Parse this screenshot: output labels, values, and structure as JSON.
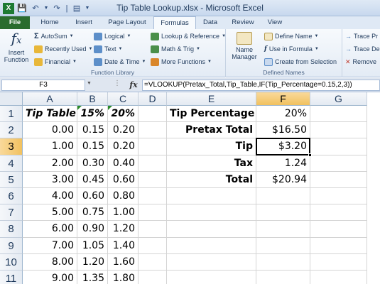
{
  "window": {
    "title": "Tip Table Lookup.xlsx - Microsoft Excel"
  },
  "tabs": [
    "File",
    "Home",
    "Insert",
    "Page Layout",
    "Formulas",
    "Data",
    "Review",
    "View"
  ],
  "ribbon": {
    "function_library": {
      "label": "Function Library",
      "insert_function": "Insert Function",
      "insert_line1": "Insert",
      "insert_line2": "Function",
      "autosum": "AutoSum",
      "recently_used": "Recently Used",
      "financial": "Financial",
      "logical": "Logical",
      "text": "Text",
      "date_time": "Date & Time",
      "lookup_reference": "Lookup & Reference",
      "math_trig": "Math & Trig",
      "more_functions": "More Functions"
    },
    "defined_names": {
      "label": "Defined Names",
      "name_manager_line1": "Name",
      "name_manager_line2": "Manager",
      "define_name": "Define Name",
      "use_in_formula": "Use in Formula",
      "create_from_selection": "Create from Selection"
    },
    "formula_auditing": {
      "trace_precedents": "Trace Pr",
      "trace_dependents": "Trace De",
      "remove_arrows": "Remove"
    }
  },
  "formula_bar": {
    "name_box": "F3",
    "fx": "fx",
    "formula": "=VLOOKUP(Pretax_Total,Tip_Table,IF(Tip_Percentage=0.15,2,3))"
  },
  "columns": [
    "A",
    "B",
    "C",
    "D",
    "E",
    "F",
    "G"
  ],
  "rows": [
    "1",
    "2",
    "3",
    "4",
    "5",
    "6",
    "7",
    "8",
    "9",
    "10",
    "11"
  ],
  "cells": {
    "A": [
      "Tip Table",
      "0.00",
      "1.00",
      "2.00",
      "3.00",
      "4.00",
      "5.00",
      "6.00",
      "7.00",
      "8.00",
      "9.00"
    ],
    "B": [
      "15%",
      "0.15",
      "0.15",
      "0.30",
      "0.45",
      "0.60",
      "0.75",
      "0.90",
      "1.05",
      "1.20",
      "1.35"
    ],
    "C": [
      "20%",
      "0.20",
      "0.20",
      "0.40",
      "0.60",
      "0.80",
      "1.00",
      "1.20",
      "1.40",
      "1.60",
      "1.80"
    ],
    "E": [
      "Tip Percentage",
      "Pretax Total",
      "Tip",
      "Tax",
      "Total"
    ],
    "F": [
      "20%",
      "$16.50",
      "$3.20",
      "1.24",
      "$20.94"
    ]
  },
  "selected_cell": "F3",
  "colors": {
    "selection_header": "#f1c15f",
    "file_tab": "#2a6c2e",
    "error_triangle": "#2a8a2a"
  }
}
